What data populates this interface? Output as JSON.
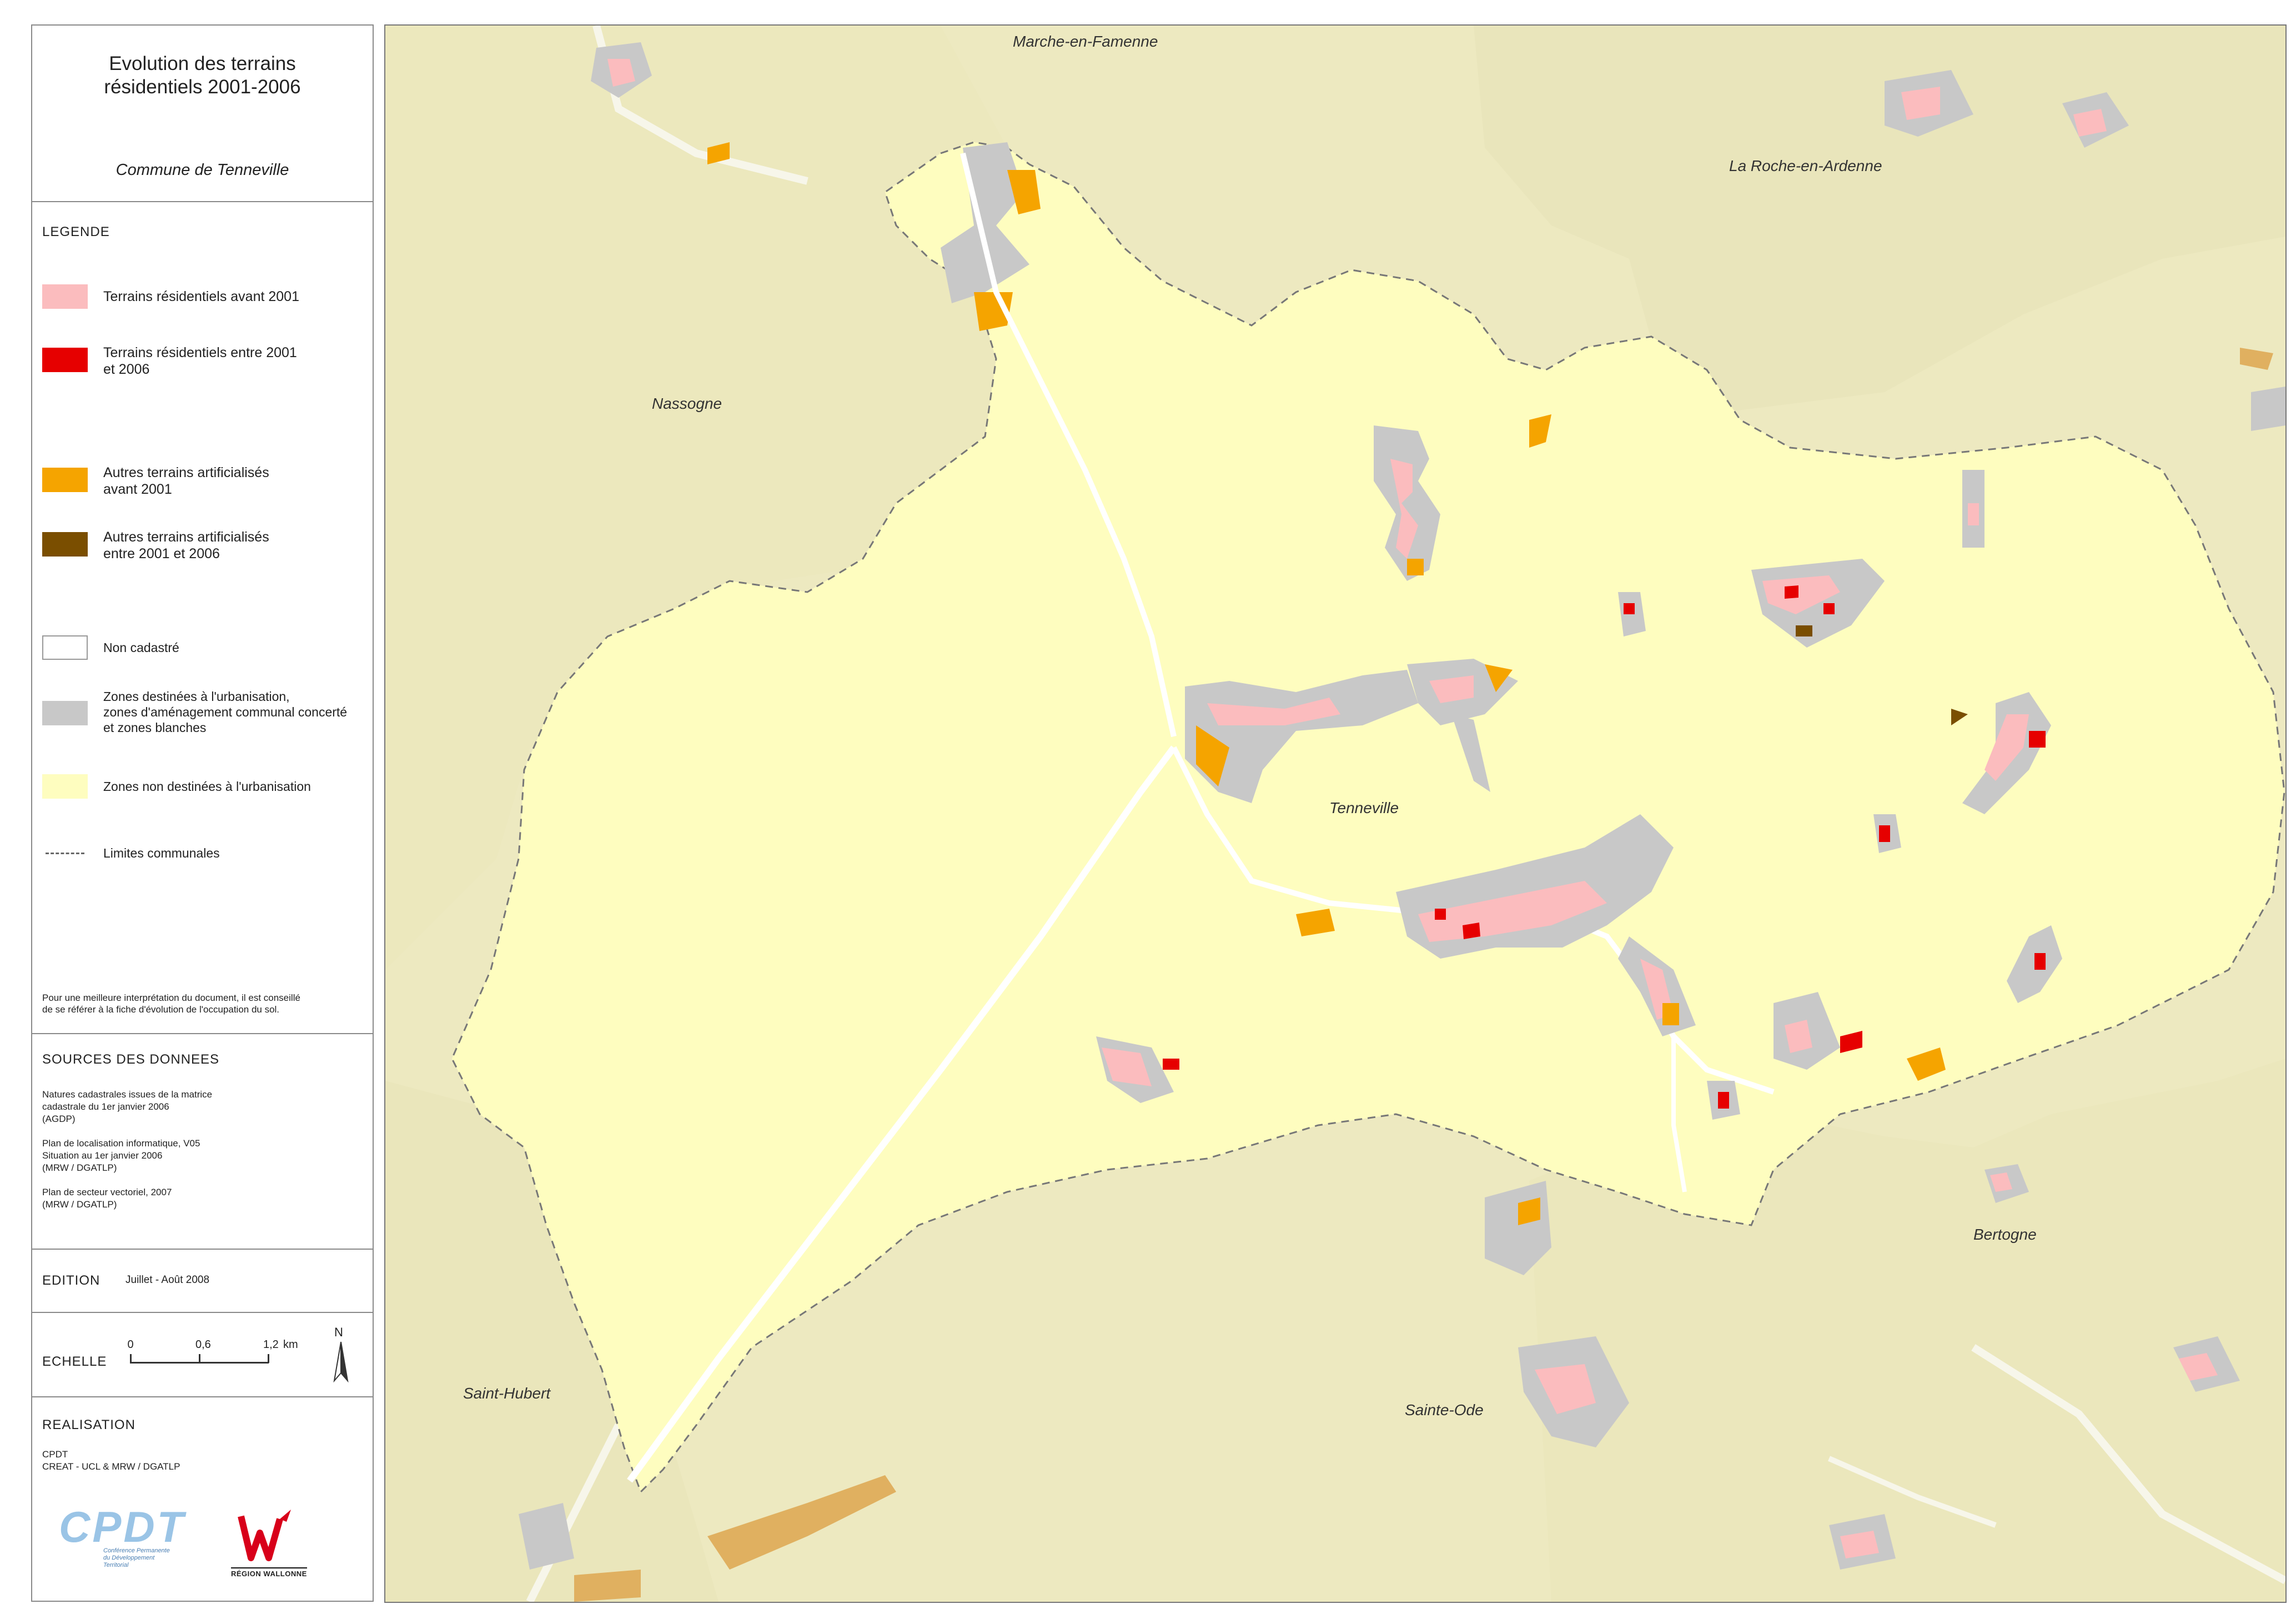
{
  "title": {
    "line1": "Evolution des terrains",
    "line2": "résidentiels 2001-2006",
    "commune": "Commune de Tenneville"
  },
  "legend": {
    "heading": "LEGENDE",
    "items": [
      {
        "label1": "Terrains résidentiels avant 2001",
        "label2": "",
        "color": "#fbbcbe"
      },
      {
        "label1": "Terrains résidentiels entre 2001",
        "label2": "et 2006",
        "color": "#e60000"
      },
      {
        "label1": "Autres terrains artificialisés",
        "label2": "avant 2001",
        "color": "#f5a400"
      },
      {
        "label1": "Autres terrains artificialisés",
        "label2": "entre 2001 et 2006",
        "color": "#7a4e00"
      },
      {
        "label1": "Non cadastré",
        "label2": "",
        "color": "#ffffff"
      },
      {
        "label1": "Zones destinées à l'urbanisation,",
        "label2": "zones d'aménagement communal concerté",
        "label3": "et zones blanches",
        "color": "#c8c8c8"
      },
      {
        "label1": "Zones non destinées à l'urbanisation",
        "label2": "",
        "color": "#fefdbf"
      },
      {
        "label1": "Limites communales",
        "label2": "",
        "color": "#666666"
      }
    ],
    "note1": "Pour une meilleure interprétation du document, il est conseillé",
    "note2": "de se référer à la fiche d'évolution de l'occupation du sol."
  },
  "sources": {
    "heading": "SOURCES DES DONNEES",
    "lines": [
      "Natures cadastrales issues de la matrice",
      "cadastrale du 1er janvier 2006",
      "(AGDP)",
      "",
      "Plan de localisation informatique, V05",
      "Situation au 1er janvier 2006",
      "(MRW / DGATLP)",
      "",
      "Plan de secteur vectoriel, 2007",
      "(MRW / DGATLP)"
    ]
  },
  "edition": {
    "heading": "EDITION",
    "value": "Juillet - Août 2008"
  },
  "scale": {
    "heading": "ECHELLE",
    "t0": "0",
    "t1": "0,6",
    "t2": "1,2",
    "unit": "km",
    "north": "N"
  },
  "realisation": {
    "heading": "REALISATION",
    "line1": "CPDT",
    "line2": "CREAT - UCL & MRW / DGATLP",
    "logo1": "CPDT",
    "logo1_sub1": "Conférence Permanente",
    "logo1_sub2": "du Développement",
    "logo1_sub3": "Territorial",
    "logo2_sub": "RÉGION WALLONNE"
  },
  "map": {
    "places": [
      "Marche-en-Famenne",
      "La Roche-en-Ardenne",
      "Nassogne",
      "Tenneville",
      "Bertogne",
      "Sainte-Ode",
      "Saint-Hubert"
    ]
  }
}
